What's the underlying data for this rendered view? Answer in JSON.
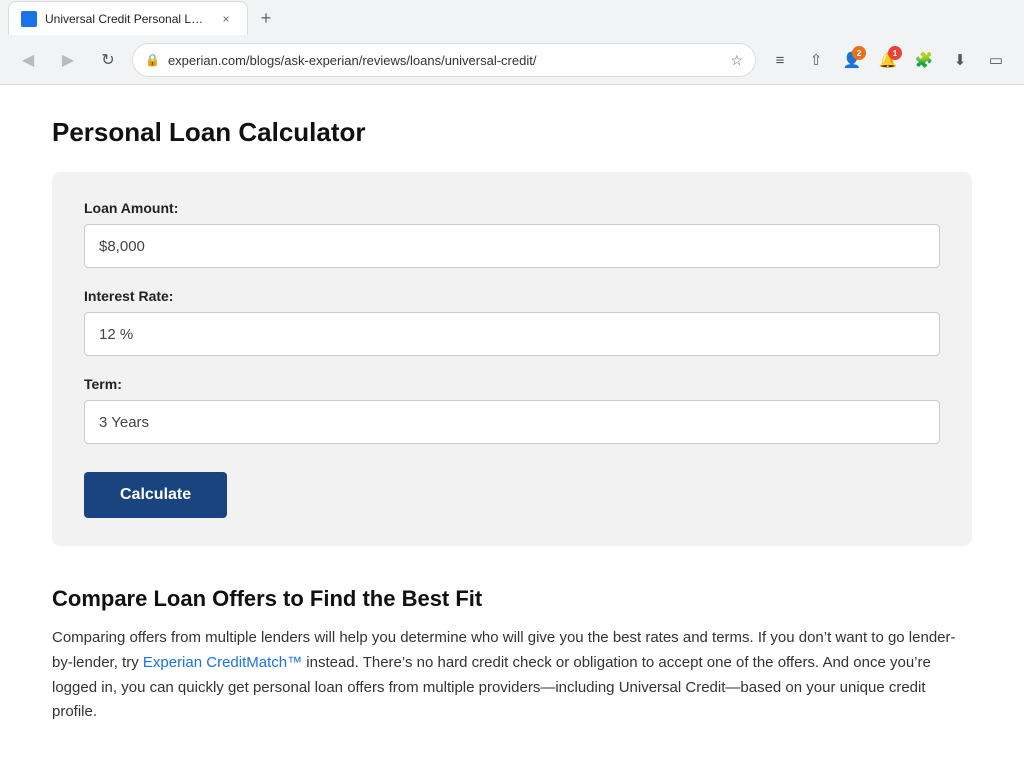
{
  "browser": {
    "tab_title": "Universal Credit Personal Loan Re",
    "tab_close_label": "×",
    "tab_new_label": "+",
    "nav": {
      "back_label": "◀",
      "forward_label": "▶",
      "reload_label": "↻",
      "address": "experian.com/blogs/ask-experian/reviews/loans/universal-credit/",
      "bookmark_label": "☆"
    },
    "actions": {
      "menu_label": "≡",
      "share_label": "⇧",
      "profile_label": "👤",
      "notification_label": "🔔",
      "extensions_label": "🧩",
      "download_label": "⬇",
      "window_label": "▭"
    }
  },
  "page": {
    "calculator": {
      "title": "Personal Loan Calculator",
      "loan_amount_label": "Loan Amount:",
      "loan_amount_value": "$8,000",
      "loan_amount_placeholder": "$8,000",
      "interest_rate_label": "Interest Rate:",
      "interest_rate_value": "12 %",
      "interest_rate_placeholder": "12 %",
      "term_label": "Term:",
      "term_value": "3 Years",
      "term_placeholder": "3 Years",
      "calculate_button": "Calculate"
    },
    "compare_section": {
      "title": "Compare Loan Offers to Find the Best Fit",
      "text_part1": "Comparing offers from multiple lenders will help you determine who will give you the best rates and terms. If you don’t want to go lender-by-lender, try ",
      "link_text": "Experian CreditMatch™",
      "text_part2": " instead. There’s no hard credit check or obligation to accept one of the offers. And once you’re logged in, you can quickly get personal loan offers from multiple providers—including Universal Credit—based on your unique credit profile."
    }
  }
}
